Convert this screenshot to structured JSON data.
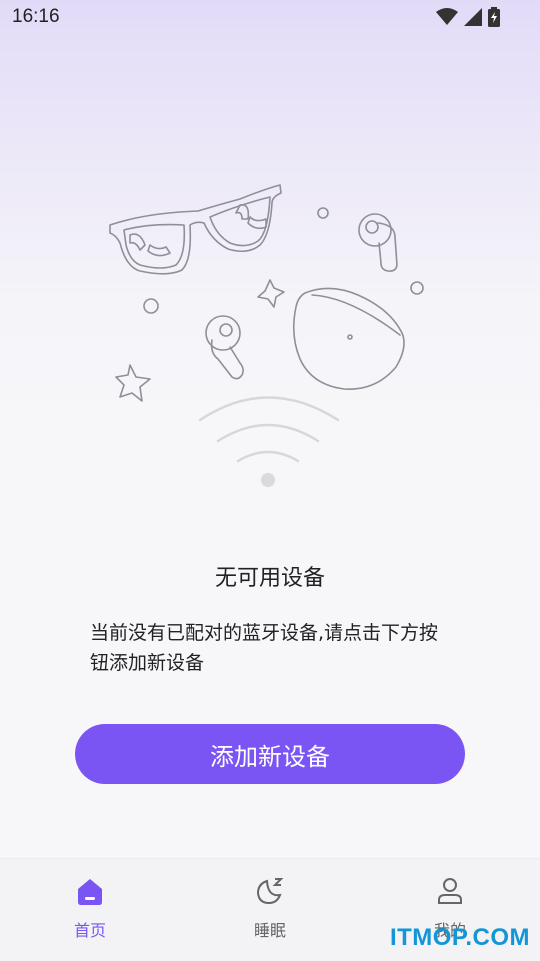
{
  "status_bar": {
    "time": "16:16",
    "icons": [
      "wifi-icon",
      "cellular-signal-icon",
      "battery-charging-icon"
    ]
  },
  "illustration": {
    "items": [
      "glasses-icon",
      "earbud-icon",
      "earbud-icon",
      "earbuds-case-icon",
      "sparkle-star-icon",
      "sparkle-star-icon",
      "bluetooth-signal-waves-icon"
    ]
  },
  "empty_state": {
    "title": "无可用设备",
    "description": "当前没有已配对的蓝牙设备,请点击下方按钮添加新设备"
  },
  "add_device_button": {
    "label": "添加新设备"
  },
  "bottom_nav": {
    "items": [
      {
        "label": "首页",
        "icon": "home-icon",
        "active": true
      },
      {
        "label": "睡眠",
        "icon": "moon-sleep-icon",
        "active": false
      },
      {
        "label": "我的",
        "icon": "user-icon",
        "active": false
      }
    ]
  },
  "colors": {
    "accent": "#7b55f3",
    "text": "#222222",
    "nav_inactive": "#666666"
  },
  "watermark": "ITMOP.COM"
}
